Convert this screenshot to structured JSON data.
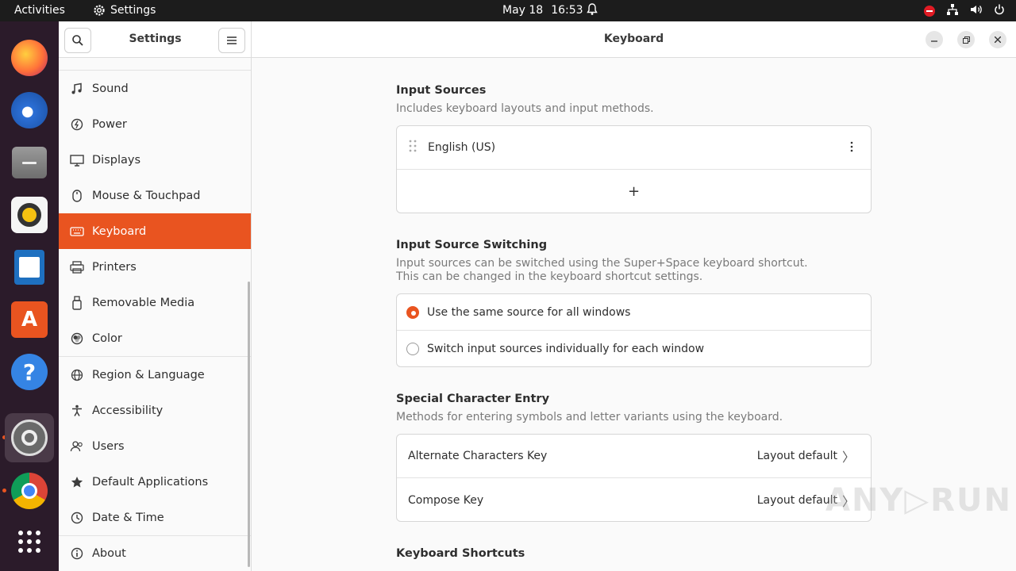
{
  "topbar": {
    "activities": "Activities",
    "app_name": "Settings",
    "date": "May 18",
    "time": "16:53"
  },
  "dock": {
    "items": [
      {
        "name": "firefox",
        "color": "#ff7139"
      },
      {
        "name": "thunderbird",
        "color": "#2b6fd6"
      },
      {
        "name": "files",
        "color": "#8e8e8e"
      },
      {
        "name": "rhythmbox",
        "color": "#f5c211"
      },
      {
        "name": "libreoffice-writer",
        "color": "#1e70c0"
      },
      {
        "name": "ubuntu-software",
        "color": "#e95420"
      },
      {
        "name": "help",
        "color": "#3584e4"
      },
      {
        "name": "settings",
        "color": "#777777"
      },
      {
        "name": "chrome",
        "color": "#4285f4"
      },
      {
        "name": "show-apps",
        "color": "#ffffff"
      }
    ]
  },
  "sidebar": {
    "title": "Settings",
    "items": [
      {
        "label": "Sound",
        "icon": "music-note-icon"
      },
      {
        "label": "Power",
        "icon": "power-icon"
      },
      {
        "label": "Displays",
        "icon": "display-icon"
      },
      {
        "label": "Mouse & Touchpad",
        "icon": "mouse-icon"
      },
      {
        "label": "Keyboard",
        "icon": "keyboard-icon"
      },
      {
        "label": "Printers",
        "icon": "printer-icon"
      },
      {
        "label": "Removable Media",
        "icon": "usb-drive-icon"
      },
      {
        "label": "Color",
        "icon": "color-icon"
      },
      {
        "label": "Region & Language",
        "icon": "globe-icon"
      },
      {
        "label": "Accessibility",
        "icon": "accessibility-icon"
      },
      {
        "label": "Users",
        "icon": "users-icon"
      },
      {
        "label": "Default Applications",
        "icon": "star-icon"
      },
      {
        "label": "Date & Time",
        "icon": "clock-icon"
      },
      {
        "label": "About",
        "icon": "info-icon"
      }
    ],
    "selected": "Keyboard"
  },
  "main": {
    "title": "Keyboard",
    "input_sources": {
      "title": "Input Sources",
      "desc": "Includes keyboard layouts and input methods.",
      "source": "English (US)",
      "add": "+"
    },
    "switching": {
      "title": "Input Source Switching",
      "desc1": "Input sources can be switched using the Super+Space keyboard shortcut.",
      "desc2": "This can be changed in the keyboard shortcut settings.",
      "option_same": "Use the same source for all windows",
      "option_individual": "Switch input sources individually for each window"
    },
    "special": {
      "title": "Special Character Entry",
      "desc": "Methods for entering symbols and letter variants using the keyboard.",
      "alt_label": "Alternate Characters Key",
      "alt_value": "Layout default",
      "compose_label": "Compose Key",
      "compose_value": "Layout default"
    },
    "shortcuts": {
      "title": "Keyboard Shortcuts"
    }
  },
  "colors": {
    "accent": "#e95420",
    "dock_bg": "#2b1b2a",
    "topbar_bg": "#1c1c1c"
  }
}
